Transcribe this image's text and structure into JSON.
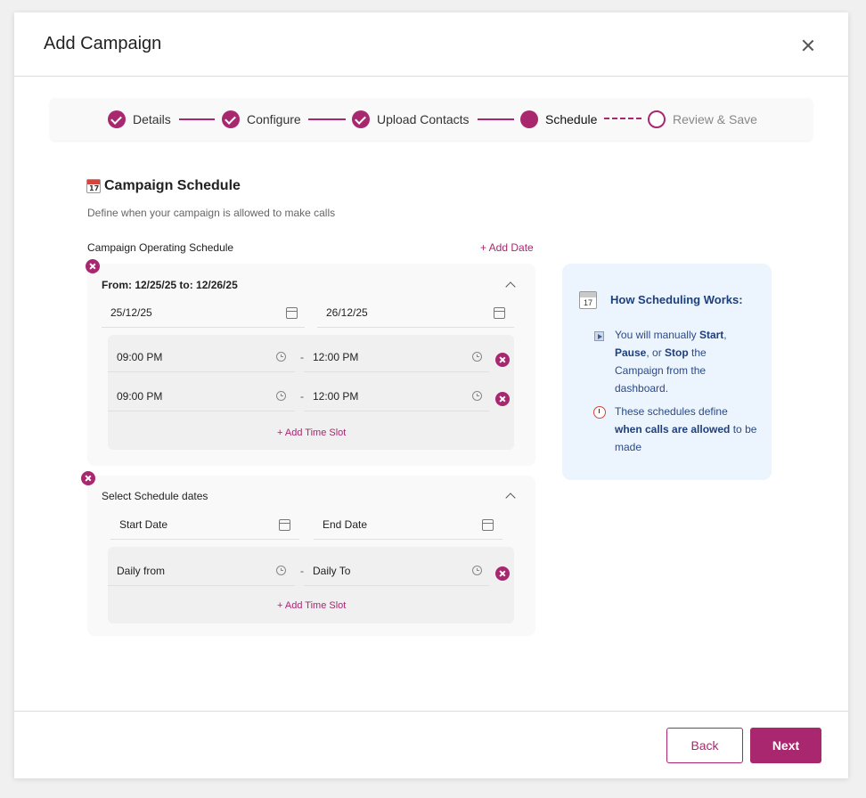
{
  "modal": {
    "title": "Add Campaign"
  },
  "stepper": {
    "steps": [
      {
        "label": "Details",
        "state": "done"
      },
      {
        "label": "Configure",
        "state": "done"
      },
      {
        "label": "Upload Contacts",
        "state": "done"
      },
      {
        "label": "Schedule",
        "state": "active"
      },
      {
        "label": "Review & Save",
        "state": "todo"
      }
    ]
  },
  "schedule": {
    "title": "Campaign Schedule",
    "subtitle": "Define when your campaign is allowed to make calls",
    "operating_label": "Campaign Operating Schedule",
    "add_date_label": "+ Add Date",
    "card1": {
      "heading": "From: 12/25/25 to: 12/26/25",
      "start_date": "25/12/25",
      "end_date": "26/12/25",
      "slots": [
        {
          "from": "09:00 PM",
          "to": "12:00 PM"
        },
        {
          "from": "09:00 PM",
          "to": "12:00 PM"
        }
      ],
      "add_slot_label": "+ Add Time Slot",
      "separator": "-"
    },
    "card2": {
      "heading": "Select Schedule dates",
      "start_placeholder": "Start Date",
      "end_placeholder": "End Date",
      "slot_from_placeholder": "Daily from",
      "slot_to_placeholder": "Daily To",
      "add_slot_label": "+ Add Time Slot",
      "separator": "-"
    }
  },
  "info": {
    "title": "How Scheduling Works:",
    "item1": "You will manually <b>Start</b>, <b>Pause</b>, or <b>Stop</b> the Campaign from the dashboard.",
    "item2": "These schedules define <b>when calls are allowed</b> to be made"
  },
  "footer": {
    "back_label": "Back",
    "next_label": "Next"
  },
  "colors": {
    "accent": "#a8276f",
    "info_bg": "#ecf4fd",
    "info_text": "#1f3f7a"
  }
}
